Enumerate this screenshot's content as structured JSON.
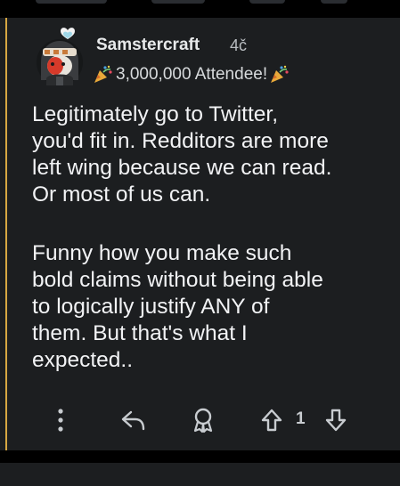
{
  "comment": {
    "author": "Samstercraft",
    "age": "4č",
    "flair_text": "3,000,000 Attendee!",
    "flair_icons": [
      "party-popper-icon",
      "party-popper-icon"
    ],
    "body": [
      [
        "Legitimately go to Twitter,",
        "you'd fit in. Redditors are more",
        "left wing because we can read.",
        "Or most of us can."
      ],
      [
        "Funny how you make such",
        "bold claims without being able",
        "to logically justify ANY of",
        "them. But that's what I",
        "expected.."
      ]
    ],
    "vote_count": "1"
  },
  "actions": {
    "more": "more-options-icon",
    "reply": "reply-icon",
    "award": "award-icon",
    "upvote": "upvote-icon",
    "downvote": "downvote-icon"
  },
  "colors": {
    "background": "#000000",
    "card": "#1c1e20",
    "text": "#f2f3f5",
    "muted": "#b9bdc1",
    "thread_line": "#d7a742"
  }
}
